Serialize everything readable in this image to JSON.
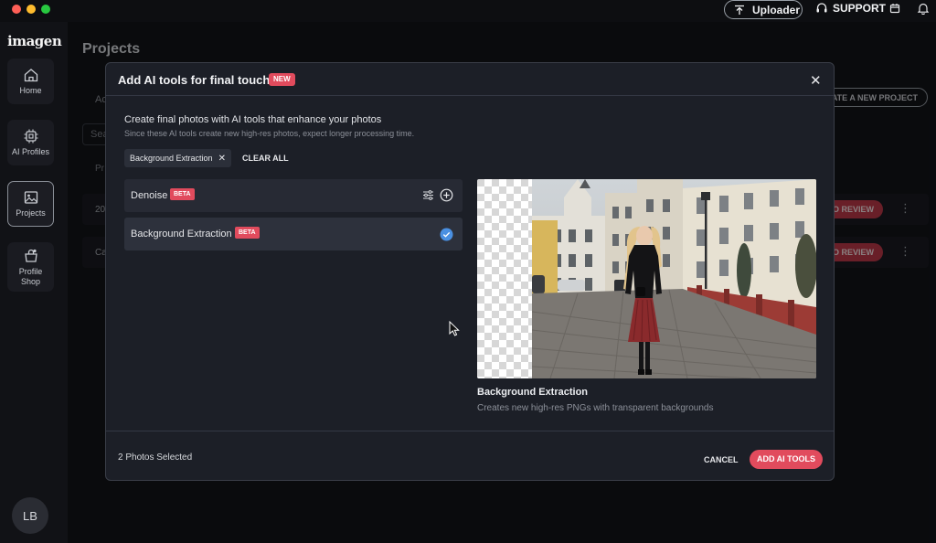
{
  "titlebar": {
    "uploader_label": "Uploader",
    "support_label": "SUPPORT"
  },
  "sidebar": {
    "logo": "imagen",
    "items": [
      {
        "label": "Home",
        "icon": "home-icon"
      },
      {
        "label": "AI Profiles",
        "icon": "cpu-icon"
      },
      {
        "label": "Projects",
        "icon": "image-icon"
      },
      {
        "label": "Profile Shop",
        "icon": "shop-icon"
      }
    ],
    "avatar_initials": "LB"
  },
  "background_page": {
    "title": "Projects",
    "tab_partial": "Ac",
    "search_partial": "Sea",
    "column_partial": "Pr",
    "create_project_partial": "EATE A NEW PROJECT",
    "rows": [
      {
        "name_partial": "20",
        "action": "TO REVIEW"
      },
      {
        "name_partial": "Ca",
        "action": "TO REVIEW"
      }
    ]
  },
  "modal": {
    "title": "Add AI tools for final touches",
    "badge": "NEW",
    "intro": "Create final photos with AI tools that enhance your photos",
    "intro_sub": "Since these AI tools create new high-res photos, expect longer processing time.",
    "chips": [
      "Background Extraction"
    ],
    "clear_all": "CLEAR ALL",
    "tools": [
      {
        "label": "Denoise",
        "badge": "BETA",
        "selected": false
      },
      {
        "label": "Background Extraction",
        "badge": "BETA",
        "selected": true
      }
    ],
    "preview": {
      "title": "Background Extraction",
      "description": "Creates new high-res PNGs with transparent backgrounds"
    },
    "footer": {
      "selected_count": "2 Photos Selected",
      "cancel": "CANCEL",
      "add": "ADD AI TOOLS"
    }
  },
  "colors": {
    "accent": "#e14b5d",
    "check": "#4a90e2",
    "background": "#131419",
    "modal": "#1c1f27"
  }
}
